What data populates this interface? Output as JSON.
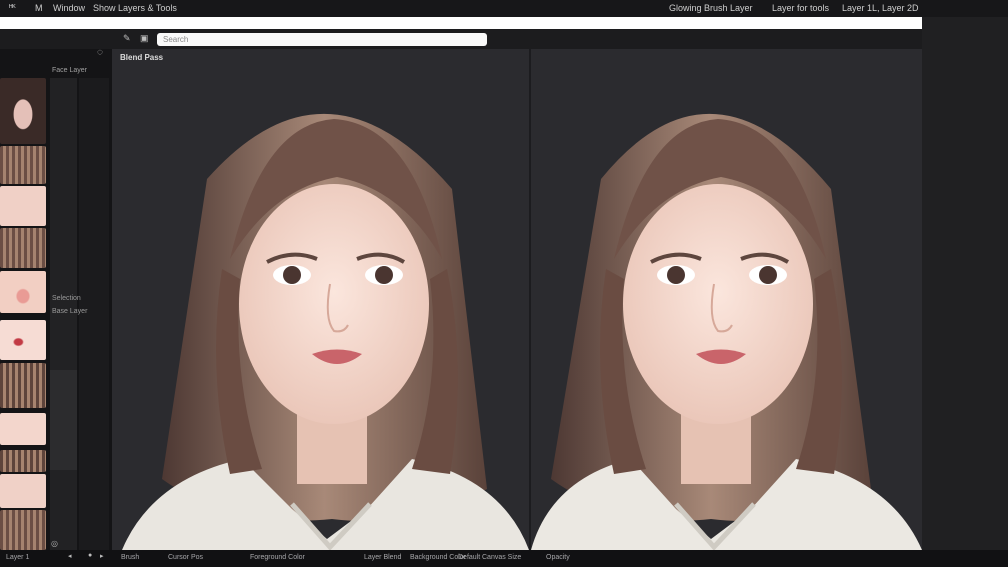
{
  "menubar": {
    "logo": "ᴴᴷ",
    "item_m": "M",
    "window_label": "Window",
    "title": "Show Layers & Tools",
    "right_a": "Glowing Brush Layer",
    "right_b": "Layer for tools",
    "right_c": "Layer 1L, Layer 2D"
  },
  "sidebar": {
    "header": "Face Layer",
    "side_text_1": "Selection",
    "side_text_2": "Base Layer",
    "bottom_icon": "◎"
  },
  "toolbar": {
    "search_placeholder": "Search"
  },
  "canvas": {
    "label": "Blend Pass"
  },
  "statusbar": {
    "item_1": "Layer 1",
    "item_2": "Brush",
    "item_3": "Cursor Pos",
    "item_4": "Foreground Color",
    "item_5": "Layer Blend",
    "item_6": "Background Color",
    "item_7": "Default",
    "item_8": "Canvas Size",
    "item_9": "Opacity"
  },
  "colors": {
    "hair_dark": "#5a423a",
    "hair_light": "#a98a78",
    "skin": "#f2d9cf",
    "background": "#2b2b2f",
    "sweater": "#e9e6e0",
    "lips": "#c9646a"
  },
  "icons": {
    "settings": "gear-icon",
    "tool_a": "brush-icon",
    "tool_b": "layers-icon"
  }
}
